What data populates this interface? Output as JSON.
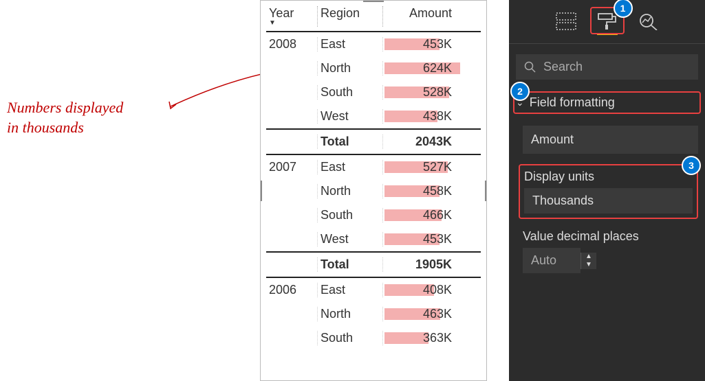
{
  "annotation": {
    "line1": "Numbers displayed",
    "line2": "in thousands"
  },
  "table": {
    "headers": {
      "year": "Year",
      "region": "Region",
      "amount": "Amount"
    },
    "groups": [
      {
        "year": "2008",
        "rows": [
          {
            "region": "East",
            "amount": "453K",
            "bar_pct": 73
          },
          {
            "region": "North",
            "amount": "624K",
            "bar_pct": 100
          },
          {
            "region": "South",
            "amount": "528K",
            "bar_pct": 85
          },
          {
            "region": "West",
            "amount": "438K",
            "bar_pct": 70
          }
        ],
        "total_label": "Total",
        "total_amount": "2043K"
      },
      {
        "year": "2007",
        "rows": [
          {
            "region": "East",
            "amount": "527K",
            "bar_pct": 84
          },
          {
            "region": "North",
            "amount": "458K",
            "bar_pct": 73
          },
          {
            "region": "South",
            "amount": "466K",
            "bar_pct": 75
          },
          {
            "region": "West",
            "amount": "453K",
            "bar_pct": 73
          }
        ],
        "total_label": "Total",
        "total_amount": "1905K"
      },
      {
        "year": "2006",
        "rows": [
          {
            "region": "East",
            "amount": "408K",
            "bar_pct": 65
          },
          {
            "region": "North",
            "amount": "463K",
            "bar_pct": 74
          },
          {
            "region": "South",
            "amount": "363K",
            "bar_pct": 58
          }
        ],
        "total_label": "",
        "total_amount": ""
      }
    ]
  },
  "pane": {
    "search_placeholder": "Search",
    "section_title": "Field formatting",
    "field_selected": "Amount",
    "display_units_label": "Display units",
    "display_units_value": "Thousands",
    "decimal_label": "Value decimal places",
    "decimal_value": "Auto",
    "callout1": "1",
    "callout2": "2",
    "callout3": "3"
  },
  "chart_data": {
    "type": "table",
    "columns": [
      "Year",
      "Region",
      "Amount"
    ],
    "rows": [
      [
        "2008",
        "East",
        453000
      ],
      [
        "2008",
        "North",
        624000
      ],
      [
        "2008",
        "South",
        528000
      ],
      [
        "2008",
        "West",
        438000
      ],
      [
        "2008",
        "Total",
        2043000
      ],
      [
        "2007",
        "East",
        527000
      ],
      [
        "2007",
        "North",
        458000
      ],
      [
        "2007",
        "South",
        466000
      ],
      [
        "2007",
        "West",
        453000
      ],
      [
        "2007",
        "Total",
        1905000
      ],
      [
        "2006",
        "East",
        408000
      ],
      [
        "2006",
        "North",
        463000
      ],
      [
        "2006",
        "South",
        363000
      ]
    ],
    "title": "Amount by Year and Region (display units: Thousands)"
  }
}
